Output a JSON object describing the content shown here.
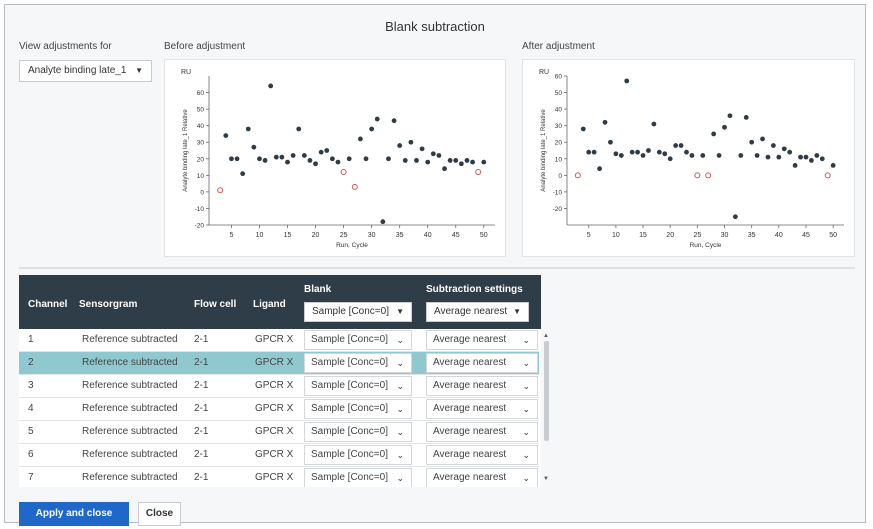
{
  "dialog": {
    "title": "Blank subtraction",
    "view_label": "View adjustments for",
    "view_value": "Analyte binding late_1",
    "before_label": "Before adjustment",
    "after_label": "After adjustment"
  },
  "table": {
    "headers": {
      "channel": "Channel",
      "sensorgram": "Sensorgram",
      "flow_cell": "Flow cell",
      "ligand": "Ligand",
      "blank": "Blank",
      "subtraction": "Subtraction settings"
    },
    "header_blank_select": "Sample [Conc=0]",
    "header_subtraction_select": "Average nearest",
    "rows": [
      {
        "channel": "1",
        "sensorgram": "Reference subtracted",
        "flow_cell": "2-1",
        "ligand": "GPCR X",
        "blank": "Sample [Conc=0]",
        "subtraction": "Average nearest"
      },
      {
        "channel": "2",
        "sensorgram": "Reference subtracted",
        "flow_cell": "2-1",
        "ligand": "GPCR X",
        "blank": "Sample [Conc=0]",
        "subtraction": "Average nearest"
      },
      {
        "channel": "3",
        "sensorgram": "Reference subtracted",
        "flow_cell": "2-1",
        "ligand": "GPCR X",
        "blank": "Sample [Conc=0]",
        "subtraction": "Average nearest"
      },
      {
        "channel": "4",
        "sensorgram": "Reference subtracted",
        "flow_cell": "2-1",
        "ligand": "GPCR X",
        "blank": "Sample [Conc=0]",
        "subtraction": "Average nearest"
      },
      {
        "channel": "5",
        "sensorgram": "Reference subtracted",
        "flow_cell": "2-1",
        "ligand": "GPCR X",
        "blank": "Sample [Conc=0]",
        "subtraction": "Average nearest"
      },
      {
        "channel": "6",
        "sensorgram": "Reference subtracted",
        "flow_cell": "2-1",
        "ligand": "GPCR X",
        "blank": "Sample [Conc=0]",
        "subtraction": "Average nearest"
      },
      {
        "channel": "7",
        "sensorgram": "Reference subtracted",
        "flow_cell": "2-1",
        "ligand": "GPCR X",
        "blank": "Sample [Conc=0]",
        "subtraction": "Average nearest"
      }
    ],
    "selected_row": 1
  },
  "buttons": {
    "apply": "Apply and close",
    "close": "Close"
  },
  "colors": {
    "accent": "#1f68c9",
    "header_bg": "#2e3d48",
    "selected_row": "#8fc9cf",
    "point": "#2f3b45",
    "blank_point": "#d9534f"
  },
  "icons": {
    "dropdown": "caret-down-icon",
    "row_select": "chevron-down-icon"
  },
  "chart_data": [
    {
      "type": "scatter",
      "unit_label": "RU",
      "xlabel": "Run, Cycle",
      "ylabel": "Analyte binding late_1 Relative",
      "xlim": [
        1,
        52
      ],
      "ylim": [
        -20,
        70
      ],
      "xticks": [
        5,
        10,
        15,
        20,
        25,
        30,
        35,
        40,
        45,
        50
      ],
      "yticks": [
        -20,
        -10,
        0,
        10,
        20,
        30,
        40,
        50,
        60
      ],
      "grid": false,
      "series": [
        {
          "role": "sample",
          "points": [
            [
              4,
              34
            ],
            [
              5,
              20
            ],
            [
              6,
              20
            ],
            [
              7,
              11
            ],
            [
              8,
              38
            ],
            [
              9,
              27
            ],
            [
              10,
              20
            ],
            [
              11,
              19
            ],
            [
              12,
              64
            ],
            [
              13,
              21
            ],
            [
              14,
              21
            ],
            [
              15,
              18
            ],
            [
              16,
              22
            ],
            [
              17,
              38
            ],
            [
              18,
              22
            ],
            [
              19,
              19
            ],
            [
              20,
              17
            ],
            [
              21,
              24
            ],
            [
              22,
              25
            ],
            [
              23,
              20
            ],
            [
              24,
              18
            ],
            [
              26,
              20
            ],
            [
              28,
              32
            ],
            [
              29,
              20
            ],
            [
              30,
              38
            ],
            [
              31,
              44
            ],
            [
              32,
              -18
            ],
            [
              33,
              20
            ],
            [
              34,
              43
            ],
            [
              35,
              28
            ],
            [
              36,
              19
            ],
            [
              37,
              30
            ],
            [
              38,
              19
            ],
            [
              39,
              26
            ],
            [
              40,
              18
            ],
            [
              41,
              23
            ],
            [
              42,
              22
            ],
            [
              43,
              14
            ],
            [
              44,
              19
            ],
            [
              45,
              19
            ],
            [
              46,
              17
            ],
            [
              47,
              19
            ],
            [
              48,
              18
            ],
            [
              50,
              18
            ]
          ]
        },
        {
          "role": "blank",
          "points": [
            [
              3,
              1
            ],
            [
              25,
              12
            ],
            [
              27,
              3
            ],
            [
              49,
              12
            ]
          ]
        }
      ]
    },
    {
      "type": "scatter",
      "unit_label": "RU",
      "xlabel": "Run, Cycle",
      "ylabel": "Analyte binding late_1 Relative",
      "xlim": [
        1,
        52
      ],
      "ylim": [
        -30,
        60
      ],
      "xticks": [
        5,
        10,
        15,
        20,
        25,
        30,
        35,
        40,
        45,
        50
      ],
      "yticks": [
        -20,
        -10,
        0,
        10,
        20,
        30,
        40,
        50,
        60
      ],
      "grid": false,
      "series": [
        {
          "role": "sample",
          "points": [
            [
              4,
              28
            ],
            [
              5,
              14
            ],
            [
              6,
              14
            ],
            [
              7,
              4
            ],
            [
              8,
              32
            ],
            [
              9,
              20
            ],
            [
              10,
              13
            ],
            [
              11,
              12
            ],
            [
              12,
              57
            ],
            [
              13,
              14
            ],
            [
              14,
              14
            ],
            [
              15,
              12
            ],
            [
              16,
              15
            ],
            [
              17,
              31
            ],
            [
              18,
              14
            ],
            [
              19,
              13
            ],
            [
              20,
              10
            ],
            [
              21,
              18
            ],
            [
              22,
              18
            ],
            [
              23,
              14
            ],
            [
              24,
              12
            ],
            [
              26,
              12
            ],
            [
              28,
              25
            ],
            [
              29,
              12
            ],
            [
              30,
              29
            ],
            [
              31,
              36
            ],
            [
              32,
              -25
            ],
            [
              33,
              12
            ],
            [
              34,
              35
            ],
            [
              35,
              20
            ],
            [
              36,
              12
            ],
            [
              37,
              22
            ],
            [
              38,
              11
            ],
            [
              39,
              18
            ],
            [
              40,
              11
            ],
            [
              41,
              16
            ],
            [
              42,
              14
            ],
            [
              43,
              6
            ],
            [
              44,
              11
            ],
            [
              45,
              11
            ],
            [
              46,
              9
            ],
            [
              47,
              12
            ],
            [
              48,
              10
            ],
            [
              50,
              6
            ]
          ]
        },
        {
          "role": "blank",
          "points": [
            [
              3,
              0
            ],
            [
              25,
              0
            ],
            [
              27,
              0
            ],
            [
              49,
              0
            ]
          ]
        }
      ]
    }
  ]
}
